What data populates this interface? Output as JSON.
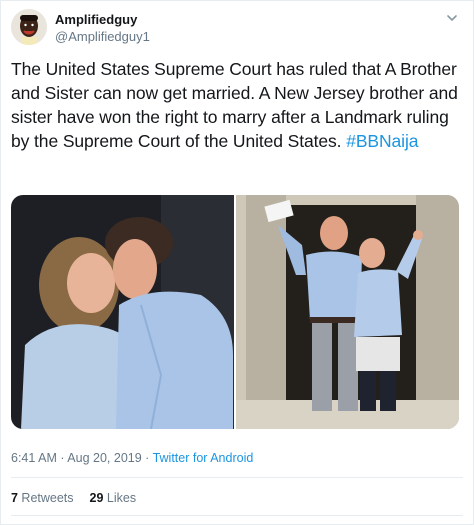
{
  "user": {
    "display_name": "Amplifiedguy",
    "handle": "@Amplifiedguy1"
  },
  "tweet": {
    "text": "The United States Supreme Court has ruled that A Brother and Sister can now get married. A New Jersey brother and sister have won the right to marry after a Landmark ruling by the Supreme Court of the United States. ",
    "hashtag": "#BBNaija"
  },
  "meta": {
    "time": "6:41 AM",
    "sep1": " · ",
    "date": "Aug 20, 2019",
    "sep2": " · ",
    "source": "Twitter for Android"
  },
  "stats": {
    "retweets_count": "7",
    "retweets_label": " Retweets",
    "likes_count": "29",
    "likes_label": " Likes"
  },
  "icons": {
    "caret": "chevron-down-icon"
  },
  "colors": {
    "link": "#1b95e0",
    "secondary_text": "#657786",
    "primary_text": "#14171a",
    "border": "#e6ecf0"
  }
}
